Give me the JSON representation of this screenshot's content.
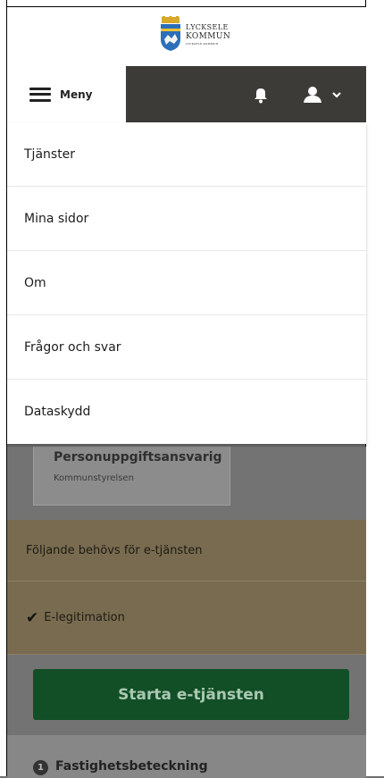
{
  "header": {
    "logo": {
      "line1": "LYCKSELE",
      "line2": "KOMMUN",
      "line3": "LYCKSELE KOMMUN"
    }
  },
  "navbar": {
    "menu_label": "Meny",
    "icons": [
      "menu-icon",
      "bell-icon",
      "user-icon",
      "chevron-down-icon"
    ]
  },
  "dropdown": {
    "items": [
      {
        "label": "Tjänster"
      },
      {
        "label": "Mina sidor"
      },
      {
        "label": "Om"
      },
      {
        "label": "Frågor och svar"
      },
      {
        "label": "Dataskydd"
      }
    ]
  },
  "content": {
    "owner": {
      "title": "Personuppgiftsansvarig",
      "subtitle": "Kommunstyrelsen"
    },
    "needs": {
      "heading": "Följande behövs för e-tjänsten",
      "items": [
        {
          "check": "✔",
          "label": "E-legitimation"
        }
      ]
    },
    "start_button": "Starta e-tjänsten",
    "step": {
      "number": "1",
      "label": "Fastighetsbeteckning"
    }
  },
  "colors": {
    "navbar": "#3c3b38",
    "start_button": "#124f27",
    "needs_background": "#786b4f",
    "overlay": "#737373"
  }
}
